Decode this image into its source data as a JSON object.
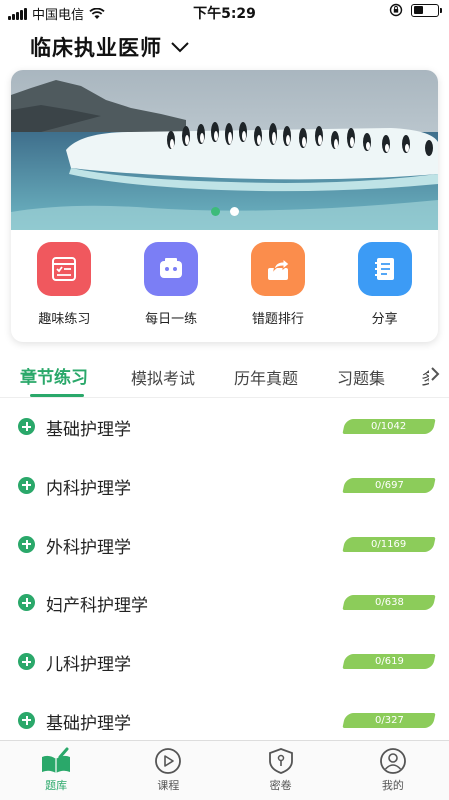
{
  "status_bar": {
    "carrier": "中国电信",
    "time": "下午5:29",
    "battery_level": 0.4
  },
  "header": {
    "title": "临床执业医师"
  },
  "banner": {
    "slide_count": 2,
    "active_slide": 1
  },
  "quick_actions": [
    {
      "label": "趣味练习",
      "icon": "quiz-icon",
      "color": "#f0585e"
    },
    {
      "label": "每日一练",
      "icon": "robot-icon",
      "color": "#7b7ef5"
    },
    {
      "label": "错题排行",
      "icon": "share-box-icon",
      "color": "#fb8d4c"
    },
    {
      "label": "分享",
      "icon": "notebook-icon",
      "color": "#3c9bf5"
    }
  ],
  "tabs": [
    {
      "label": "章节练习",
      "active": true
    },
    {
      "label": "模拟考试",
      "active": false
    },
    {
      "label": "历年真题",
      "active": false
    },
    {
      "label": "习题集",
      "active": false
    },
    {
      "label": "多",
      "active": false
    }
  ],
  "chapters": [
    {
      "name": "基础护理学",
      "progress": "0/1042"
    },
    {
      "name": "内科护理学",
      "progress": "0/697"
    },
    {
      "name": "外科护理学",
      "progress": "0/1169"
    },
    {
      "name": "妇产科护理学",
      "progress": "0/638"
    },
    {
      "name": "儿科护理学",
      "progress": "0/619"
    },
    {
      "name": "基础护理学",
      "progress": "0/327"
    }
  ],
  "bottom_nav": [
    {
      "label": "题库",
      "icon": "book-icon",
      "active": true
    },
    {
      "label": "课程",
      "icon": "play-icon",
      "active": false
    },
    {
      "label": "密卷",
      "icon": "shield-icon",
      "active": false
    },
    {
      "label": "我的",
      "icon": "user-icon",
      "active": false
    }
  ],
  "colors": {
    "accent": "#2aa86a",
    "badge": "#8ccc5a"
  }
}
